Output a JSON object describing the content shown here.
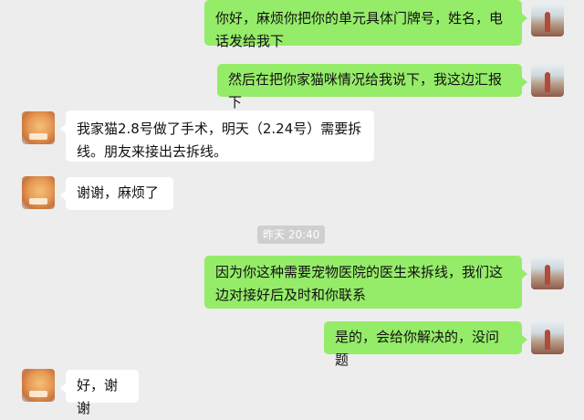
{
  "messages": [
    {
      "side": "sent",
      "avatar": "self-avatar",
      "text": "你好，麻烦你把你的单元具体门牌号，姓名，电话发给我下"
    },
    {
      "side": "sent",
      "avatar": "self-avatar",
      "text": "然后在把你家猫咪情况给我说下，我这边汇报下"
    },
    {
      "side": "recv",
      "avatar": "contact-avatar",
      "text": "我家猫2.8号做了手术，明天（2.24号）需要拆线。朋友来接出去拆线。"
    },
    {
      "side": "recv",
      "avatar": "contact-avatar",
      "text": "谢谢，麻烦了"
    },
    {
      "side": "sent",
      "avatar": "self-avatar",
      "text": "因为你这种需要宠物医院的医生来拆线，我们这边对接好后及时和你联系"
    },
    {
      "side": "sent",
      "avatar": "self-avatar",
      "text": "是的，会给你解决的，没问题"
    },
    {
      "side": "recv",
      "avatar": "contact-avatar",
      "text": "好，谢谢"
    }
  ],
  "timestamp": "昨天 20:40"
}
